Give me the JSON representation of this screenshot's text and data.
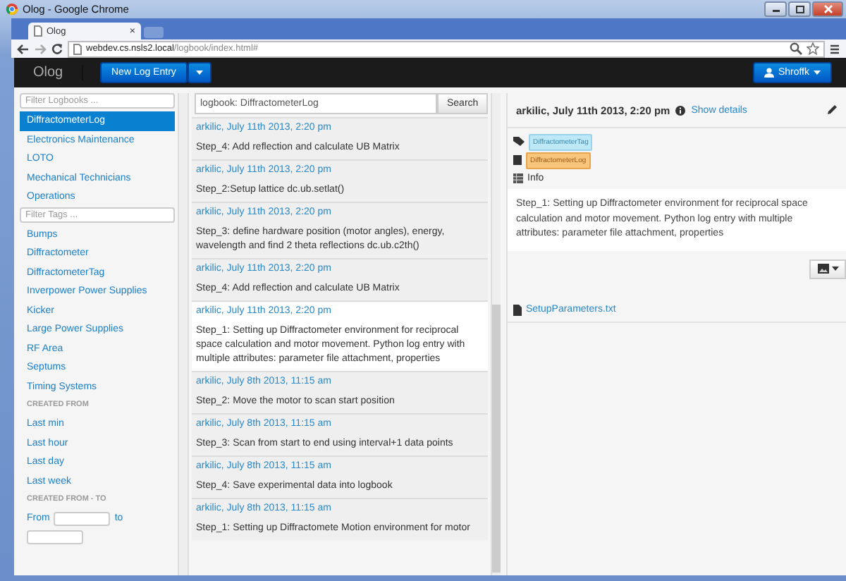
{
  "browser": {
    "title": "Olog - Google Chrome",
    "tab": "Olog",
    "tab_close": "×",
    "url_host": "webdev.cs.nsls2.local",
    "url_path": "/logbook/index.html#"
  },
  "navbar": {
    "brand": "Olog",
    "new_entry": "New Log Entry",
    "user": "Shroffk"
  },
  "logbooks": {
    "placeholder": "Filter Logbooks ...",
    "items": [
      {
        "label": "DiffractometerLog",
        "selected": true
      },
      {
        "label": "Electronics Maintenance",
        "selected": false
      },
      {
        "label": "LOTO",
        "selected": false
      },
      {
        "label": "Mechanical Technicians",
        "selected": false
      },
      {
        "label": "Operations",
        "selected": false
      }
    ]
  },
  "tags": {
    "placeholder": "Filter Tags ...",
    "items": [
      "Bumps",
      "Diffractometer",
      "DiffractometerTag",
      "Inverpower Power Supplies",
      "Kicker",
      "Large Power Supplies",
      "RF Area",
      "Septums",
      "Timing Systems"
    ]
  },
  "created_from": {
    "heading": "CREATED FROM",
    "items": [
      "Last min",
      "Last hour",
      "Last day",
      "Last week"
    ]
  },
  "created_range": {
    "heading": "CREATED FROM - TO",
    "from_label": "From",
    "to_label": "to"
  },
  "search": {
    "value": "logbook: DiffractometerLog",
    "button": "Search"
  },
  "entries": [
    {
      "header": "arkilic, July 11th 2013, 2:20 pm",
      "text": "Step_4: Add reflection and calculate UB Matrix",
      "selected": false
    },
    {
      "header": "arkilic, July 11th 2013, 2:20 pm",
      "text": "Step_2:Setup lattice dc.ub.setlat()",
      "selected": false
    },
    {
      "header": "arkilic, July 11th 2013, 2:20 pm",
      "text": "Step_3: define hardware position (motor angles), energy, wavelength and find 2 theta reflections dc.ub.c2th()",
      "selected": false
    },
    {
      "header": "arkilic, July 11th 2013, 2:20 pm",
      "text": "Step_4: Add reflection and calculate UB Matrix",
      "selected": false
    },
    {
      "header": "arkilic, July 11th 2013, 2:20 pm",
      "text": "Step_1: Setting up Diffractometer environment for reciprocal space calculation and motor movement. Python log entry with multiple attributes: parameter file attachment, properties",
      "selected": true
    },
    {
      "header": "arkilic, July 8th 2013, 11:15 am",
      "text": "Step_2: Move the motor to scan start position",
      "selected": false
    },
    {
      "header": "arkilic, July 8th 2013, 11:15 am",
      "text": "Step_3: Scan from start to end using interval+1 data points",
      "selected": false
    },
    {
      "header": "arkilic, July 8th 2013, 11:15 am",
      "text": "Step_4: Save experimental data into logbook",
      "selected": false
    },
    {
      "header": "arkilic, July 8th 2013, 11:15 am",
      "text": "Step_1: Setting up Diffractomete Motion environment for motor",
      "selected": false
    }
  ],
  "detail": {
    "header": "arkilic, July 11th 2013, 2:20 pm",
    "show_details": "Show details",
    "tag": "DiffractometerTag",
    "logbook": "DiffractometerLog",
    "property": "Info",
    "description": "Step_1: Setting up Diffractometer environment for reciprocal space calculation and motor movement. Python log entry with multiple attributes: parameter file attachment, properties",
    "attachment": "SetupParameters.txt"
  }
}
